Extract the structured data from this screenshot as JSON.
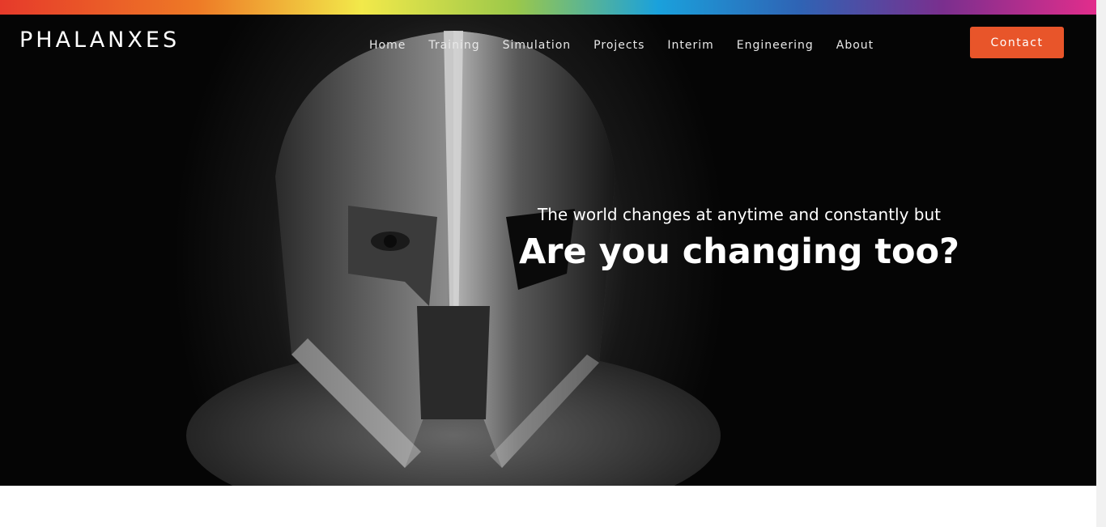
{
  "brand": {
    "logo_text": "PHALANXES"
  },
  "nav": {
    "items": [
      {
        "label": "Home"
      },
      {
        "label": "Training"
      },
      {
        "label": "Simulation"
      },
      {
        "label": "Projects"
      },
      {
        "label": "Interim"
      },
      {
        "label": "Engineering"
      },
      {
        "label": "About"
      }
    ],
    "contact_label": "Contact"
  },
  "hero": {
    "tagline": "The world changes at anytime and constantly but",
    "headline": "Are you changing too?",
    "image": "spartan-helmet-photo"
  },
  "colors": {
    "accent": "#e8552a",
    "hero_bg": "#000000",
    "text": "#ffffff"
  }
}
